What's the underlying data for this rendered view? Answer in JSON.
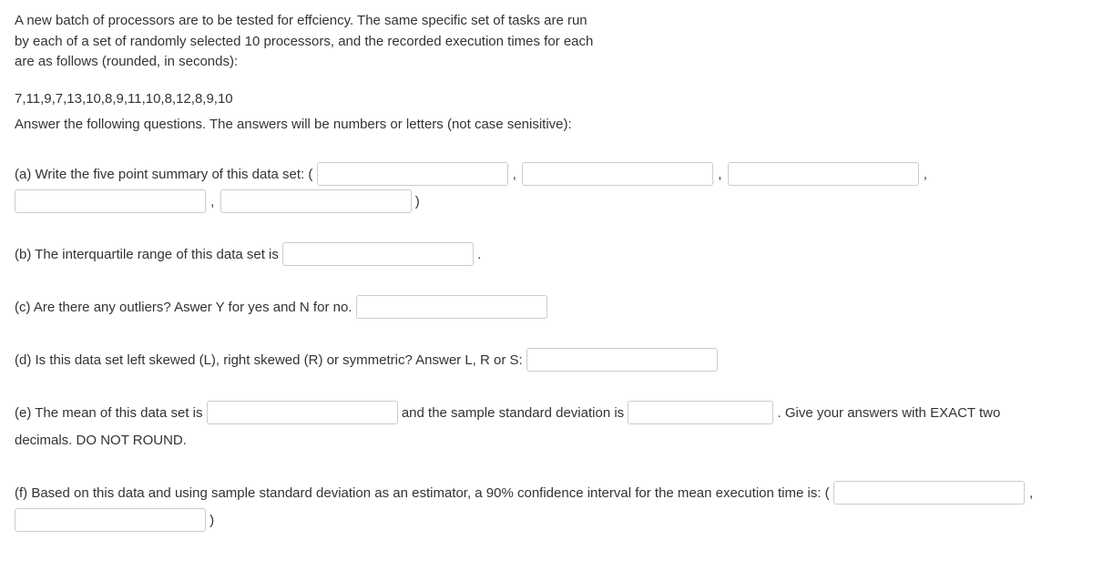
{
  "intro": {
    "line1": "A new batch of processors are to be tested for effciency. The same specific set of tasks are run",
    "line2": "by each of a set of randomly selected 10 processors, and the recorded execution times for each",
    "line3": "are as follows (rounded, in seconds):"
  },
  "data_values": "7,11,9,7,13,10,8,9,11,10,8,12,8,9,10",
  "instruction": "Answer the following questions. The answers will be numbers or letters (not case senisitive):",
  "questions": {
    "a": {
      "prefix": "(a) Write the five point summary of this data set: (",
      "close": ")"
    },
    "b": {
      "prefix": "(b) The interquartile range of this data set is",
      "suffix": "."
    },
    "c": {
      "prefix": "(c) Are there any outliers? Aswer Y for yes and N for no."
    },
    "d": {
      "prefix": "(d) Is this data set left skewed (L), right skewed (R) or symmetric? Answer L, R or S:"
    },
    "e": {
      "part1": "(e) The mean of this data set is",
      "part2": "and the sample standard deviation is",
      "part3": ". Give your answers with EXACT two",
      "part4": "decimals. DO NOT ROUND."
    },
    "f": {
      "part1": "(f)  Based on this data and using sample standard deviation as an estimator, a 90% confidence interval for the mean execution time is: (",
      "close": ")"
    }
  },
  "sep_comma": ","
}
